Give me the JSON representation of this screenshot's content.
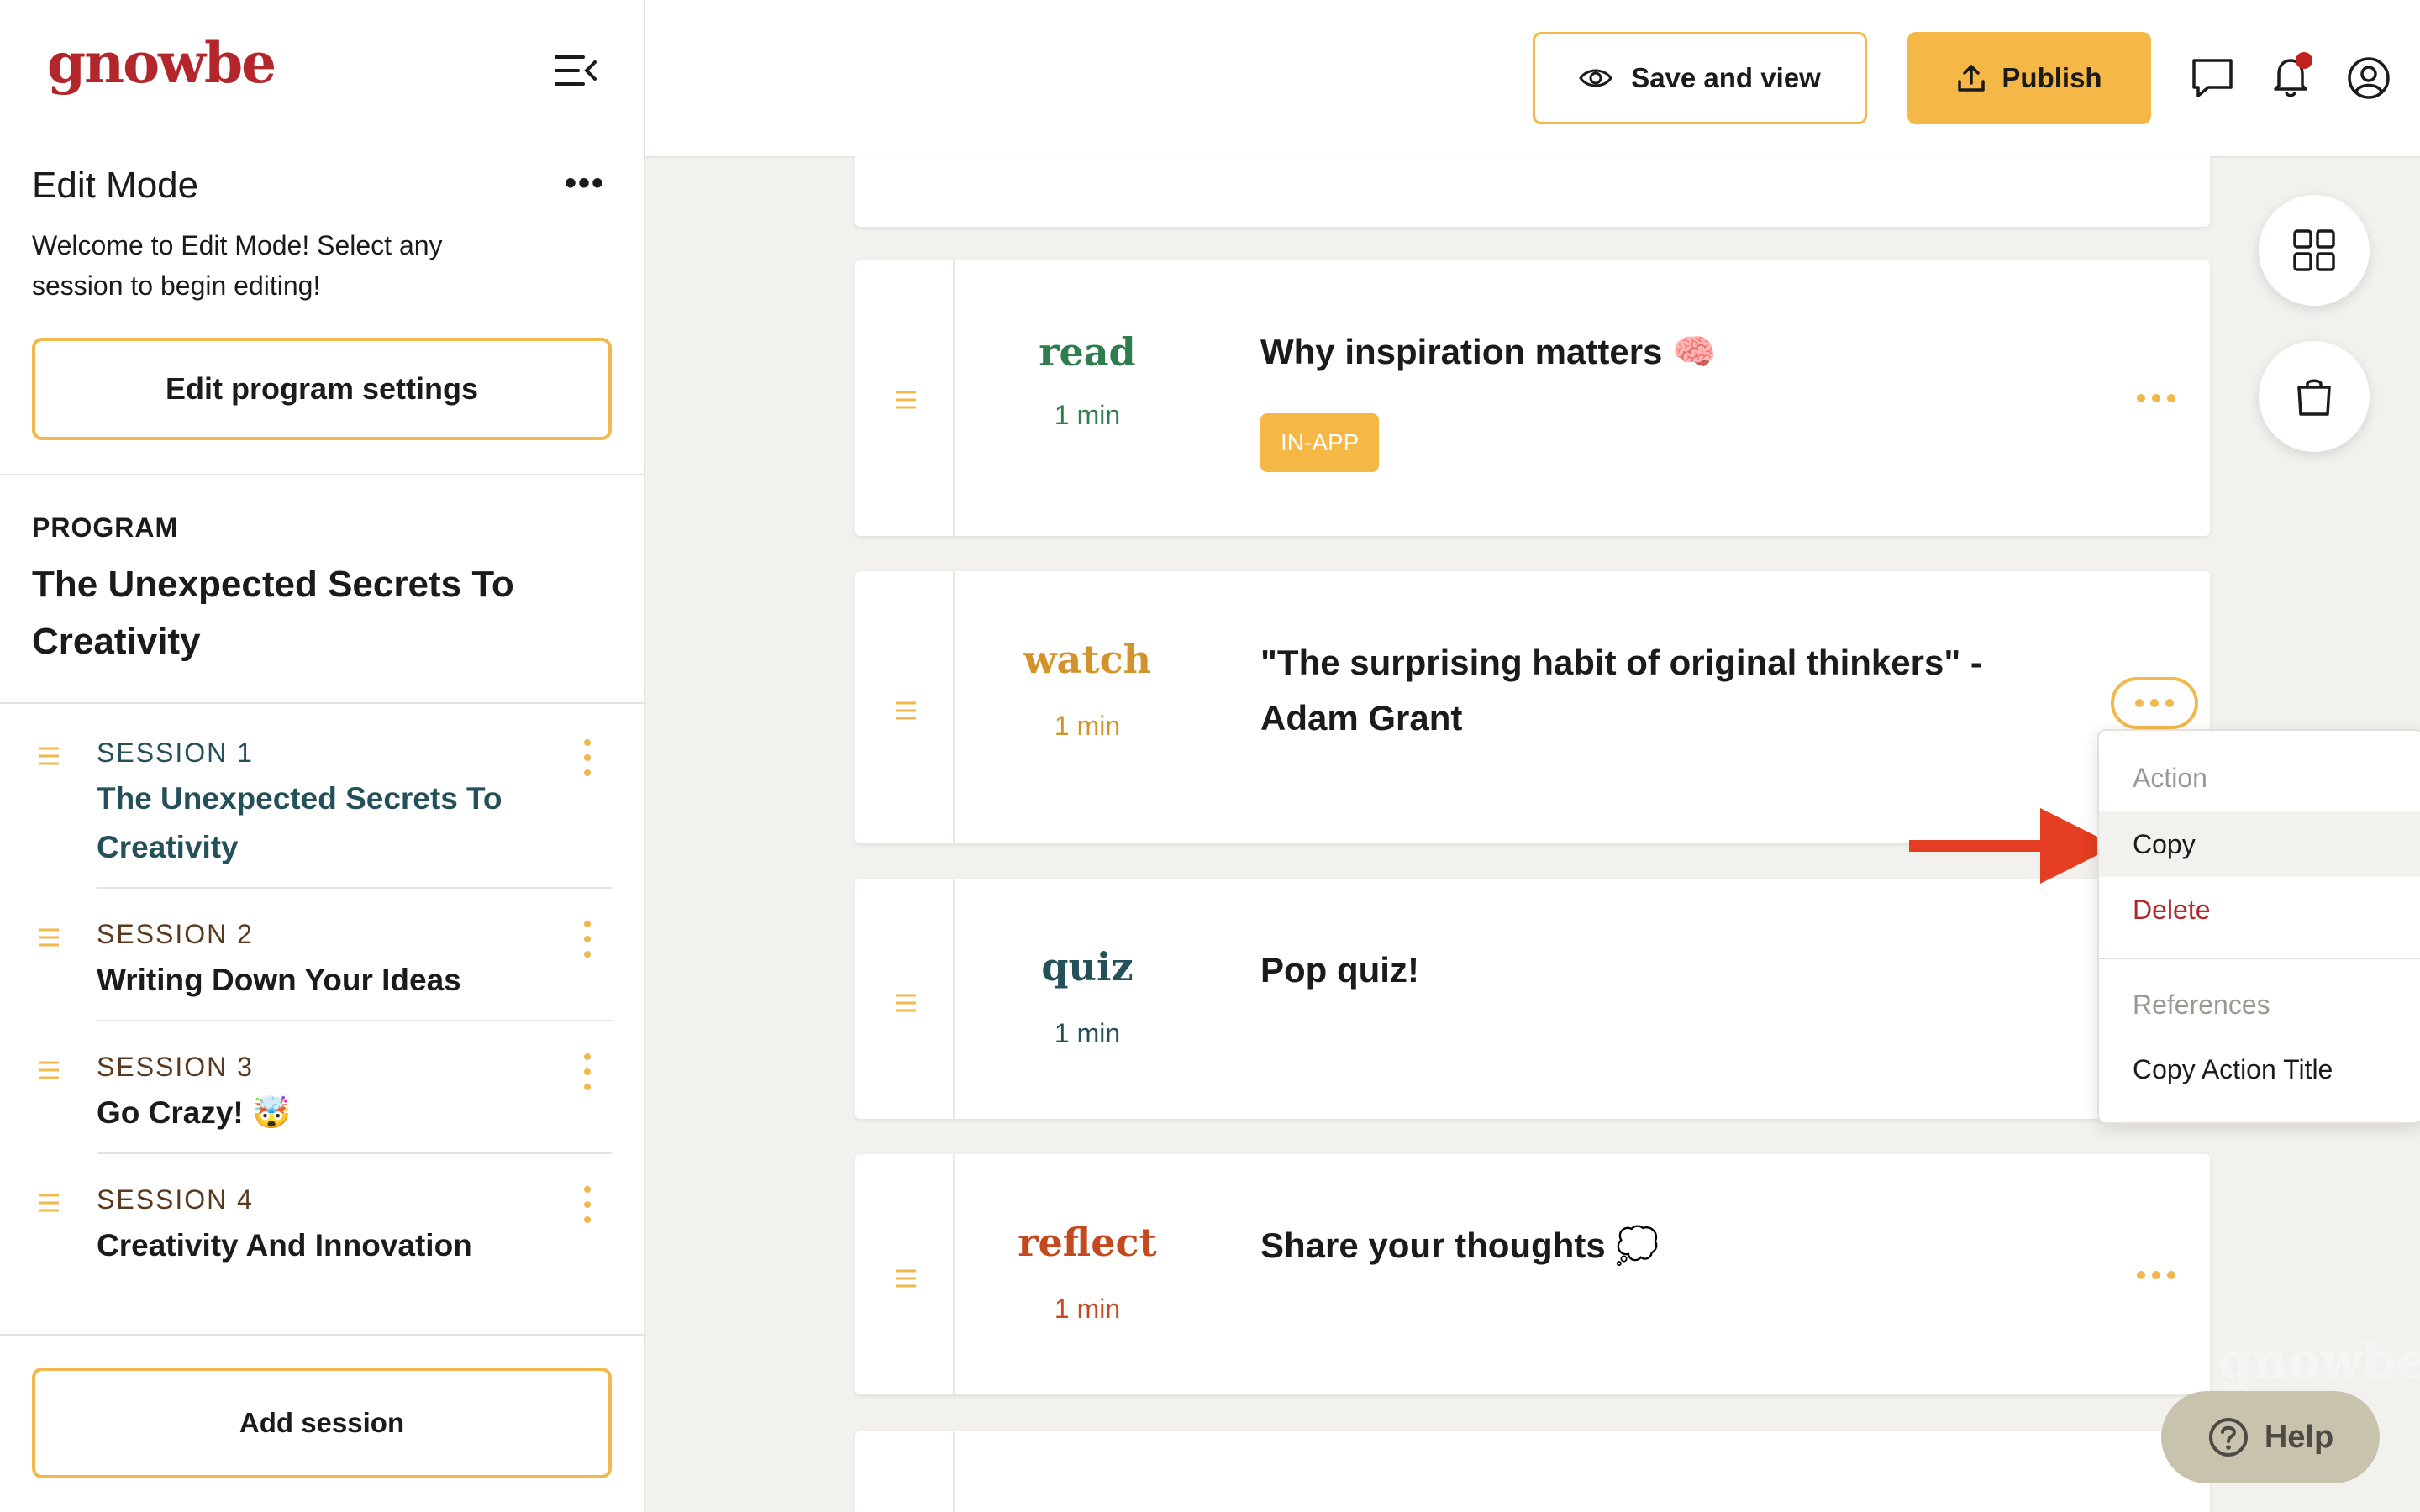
{
  "brand": {
    "logo_text": "gnowbe",
    "color": "#b3262b",
    "accent": "#f2b84b",
    "publish_color": "#f5b746"
  },
  "sidebar": {
    "edit_mode_title": "Edit Mode",
    "edit_mode_menu_icon": "more-horizontal-icon",
    "edit_mode_desc": "Welcome to Edit Mode! Select any session to begin editing!",
    "edit_settings_label": "Edit program settings",
    "program_label": "PROGRAM",
    "program_title": "The Unexpected Secrets To Creativity",
    "sessions": [
      {
        "num": "SESSION 1",
        "name": "The Unexpected Secrets To Creativity",
        "active": true
      },
      {
        "num": "SESSION 2",
        "name": "Writing Down Your Ideas",
        "active": false
      },
      {
        "num": "SESSION 3",
        "name": "Go Crazy! 🤯",
        "active": false
      },
      {
        "num": "SESSION 4",
        "name": "Creativity And Innovation",
        "active": false
      }
    ],
    "add_session_label": "Add session"
  },
  "header": {
    "save_view_label": "Save and view",
    "publish_label": "Publish",
    "icons": [
      "chat-icon",
      "bell-icon",
      "user-icon"
    ]
  },
  "cards": [
    {
      "type": "read",
      "type_color": "#2e7d4f",
      "duration": "1 min",
      "title": "Why inspiration matters 🧠",
      "badge": "IN-APP"
    },
    {
      "type": "watch",
      "type_color": "#d2932a",
      "duration": "1 min",
      "title": "\"The surprising habit of original thinkers\" - Adam Grant"
    },
    {
      "type": "quiz",
      "type_color": "#24505a",
      "duration": "1 min",
      "title": "Pop quiz!"
    },
    {
      "type": "reflect",
      "type_color": "#c24a1e",
      "duration": "1 min",
      "title": "Share your thoughts 💭"
    }
  ],
  "menu": {
    "section1": "Action",
    "copy": "Copy",
    "delete": "Delete",
    "section2": "References",
    "copy_title": "Copy Action Title",
    "delete_color": "#b3262b"
  },
  "help_label": "Help",
  "watermark": "gnowbe"
}
